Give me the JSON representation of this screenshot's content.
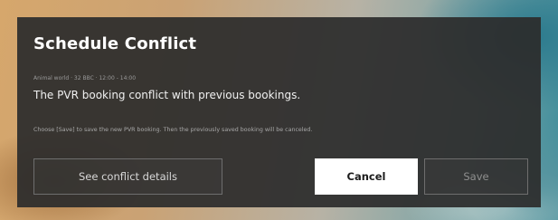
{
  "dialog": {
    "title": "Schedule Conflict",
    "meta": "Animal world · 32 BBC · 12:00 - 14:00",
    "message": "The PVR booking conflict with previous bookings.",
    "hint": "Choose [Save] to save the new PVR booking. Then the previously saved booking will be canceled."
  },
  "buttons": {
    "details_label": "See conflict details",
    "cancel_label": "Cancel",
    "save_label": "Save"
  }
}
